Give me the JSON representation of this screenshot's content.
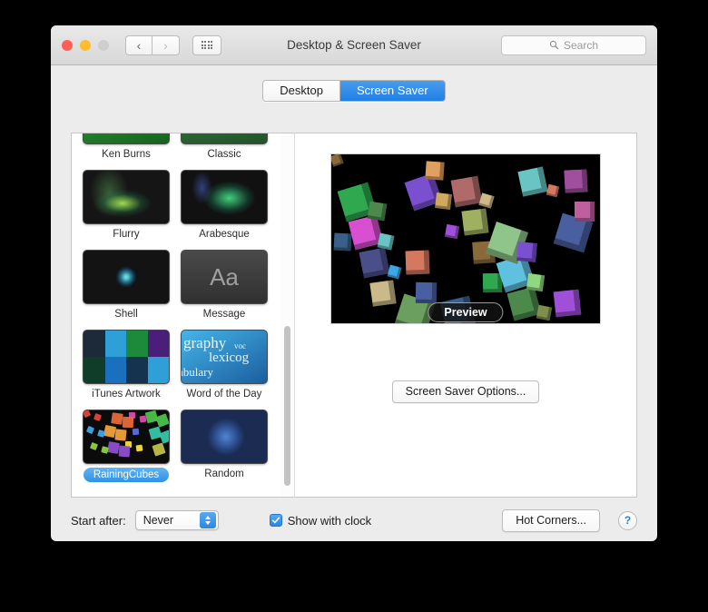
{
  "window": {
    "title": "Desktop & Screen Saver",
    "traffic_lights": [
      "close-button",
      "minimize-button",
      "zoom-button"
    ],
    "nav": {
      "back": "‹",
      "forward": "›",
      "show_all_icon": "grid-icon"
    },
    "search": {
      "placeholder": "Search",
      "value": ""
    }
  },
  "tabs": [
    {
      "label": "Desktop",
      "active": false
    },
    {
      "label": "Screen Saver",
      "active": true
    }
  ],
  "screensavers": [
    {
      "name": "Ken Burns",
      "art": "art-kenburns",
      "selected": false
    },
    {
      "name": "Classic",
      "art": "art-classic",
      "selected": false
    },
    {
      "name": "Flurry",
      "art": "art-flurry",
      "selected": false
    },
    {
      "name": "Arabesque",
      "art": "art-arabesque",
      "selected": false
    },
    {
      "name": "Shell",
      "art": "art-shell",
      "selected": false
    },
    {
      "name": "Message",
      "art": "art-message",
      "selected": false
    },
    {
      "name": "iTunes Artwork",
      "art": "art-itunes",
      "selected": false
    },
    {
      "name": "Word of the Day",
      "art": "art-wotd",
      "selected": false
    },
    {
      "name": "RainingCubes",
      "art": "art-cubes",
      "selected": true
    },
    {
      "name": "Random",
      "art": "art-random",
      "selected": false
    }
  ],
  "preview": {
    "pill_label": "Preview",
    "background": "#000000",
    "options_button": "Screen Saver Options..."
  },
  "bottom": {
    "start_after_label": "Start after:",
    "start_after_value": "Never",
    "show_clock_label": "Show with clock",
    "show_clock_checked": true,
    "hot_corners_button": "Hot Corners...",
    "help_button": "?"
  },
  "colors": {
    "accent": "#2b87e3",
    "selection": "#3b97e8",
    "window_bg": "#ececec",
    "panel_bg": "#ffffff"
  },
  "message_glyph": "Aa",
  "wotd_words": [
    "graphy",
    "lexicog",
    "abulary",
    "voc"
  ]
}
